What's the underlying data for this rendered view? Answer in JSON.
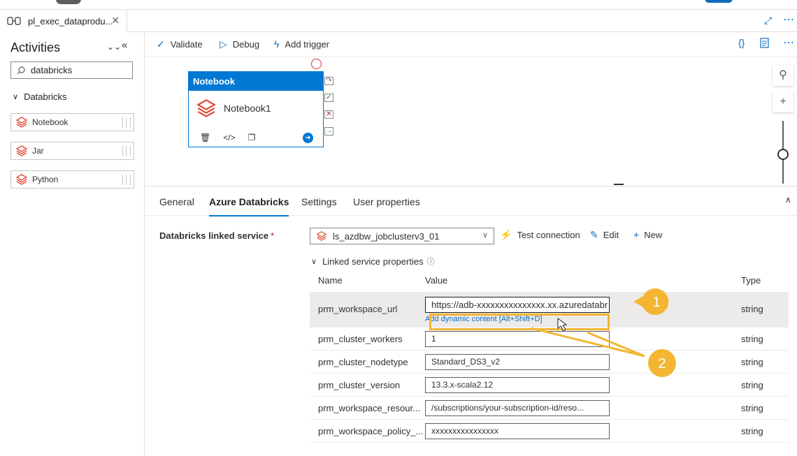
{
  "tab": {
    "title": "pl_exec_dataprodu...",
    "close_label": "✕"
  },
  "toolbar": {
    "validate": "Validate",
    "debug": "Debug",
    "add_trigger": "Add trigger"
  },
  "activities": {
    "title": "Activities",
    "search_value": "databricks",
    "group_label": "Databricks",
    "items": [
      {
        "label": "Notebook"
      },
      {
        "label": "Jar"
      },
      {
        "label": "Python"
      }
    ]
  },
  "canvas": {
    "node_type": "Notebook",
    "node_name": "Notebook1"
  },
  "props": {
    "tabs": [
      "General",
      "Azure Databricks",
      "Settings",
      "User properties"
    ],
    "active_tab": "Azure Databricks",
    "linked_service_label": "Databricks linked service",
    "required_mark": "*",
    "linked_service_value": "ls_azdbw_jobclusterv3_01",
    "test_connection": "Test connection",
    "edit": "Edit",
    "new": "New",
    "lsp_label": "Linked service properties",
    "columns": {
      "name": "Name",
      "value": "Value",
      "type": "Type"
    },
    "dynamic_content": "Add dynamic content [Alt+Shift+D]",
    "rows": [
      {
        "name": "prm_workspace_url",
        "value": "https://adb-xxxxxxxxxxxxxxx.xx.azuredatabr",
        "type": "string"
      },
      {
        "name": "prm_cluster_workers",
        "value": "1",
        "type": "string"
      },
      {
        "name": "prm_cluster_nodetype",
        "value": "Standard_DS3_v2",
        "type": "string"
      },
      {
        "name": "prm_cluster_version",
        "value": "13.3.x-scala2.12",
        "type": "string"
      },
      {
        "name": "prm_workspace_resour...",
        "value": "/subscriptions/your-subscription-id/reso...",
        "type": "string"
      },
      {
        "name": "prm_workspace_policy_...",
        "value": "xxxxxxxxxxxxxxxx",
        "type": "string"
      }
    ]
  },
  "annotations": {
    "callout1": "1",
    "callout2": "2"
  },
  "colors": {
    "accent": "#0078d4",
    "highlight": "#f2b632",
    "databricks_red": "#e2462f"
  }
}
